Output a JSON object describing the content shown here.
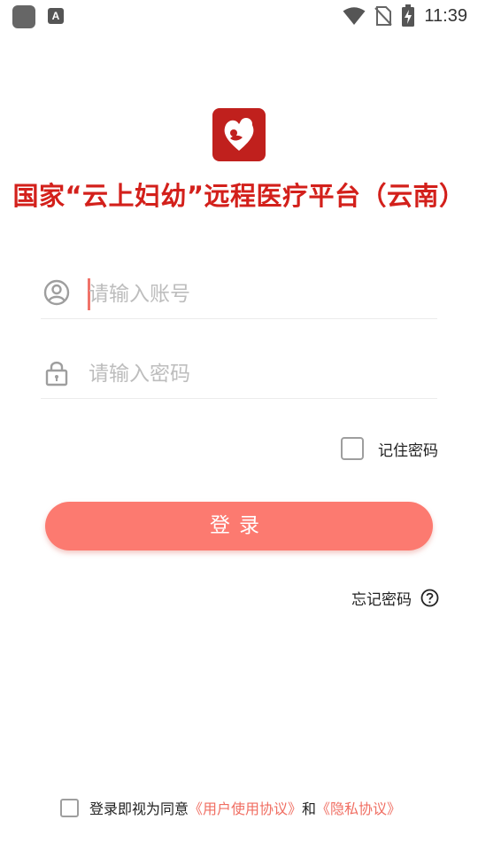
{
  "status_bar": {
    "time": "11:39",
    "notification_icon": "a-icon",
    "icons": [
      "wifi-icon",
      "no-sim-icon",
      "battery-charging-icon"
    ]
  },
  "header": {
    "logo_icon": "hospital-logo-icon",
    "title": "国家“云上妇幼”远程医疗平台（云南）"
  },
  "login_form": {
    "account": {
      "placeholder": "请输入账号",
      "value": "",
      "icon": "user-icon"
    },
    "password": {
      "placeholder": "请输入密码",
      "value": "",
      "icon": "lock-icon"
    },
    "remember": {
      "label": "记住密码",
      "checked": false
    },
    "submit_label": "登录",
    "forgot_label": "忘记密码",
    "forgot_icon": "help-circle-icon"
  },
  "agreement": {
    "checked": false,
    "prefix": "登录即视为同意",
    "user_agreement": "《用户使用协议》",
    "and": "和",
    "privacy_policy": "《隐私协议》"
  },
  "colors": {
    "accent": "#fc7a70",
    "title_red": "#d3201b",
    "link": "#f06e62",
    "logo_bg": "#c0201d"
  }
}
